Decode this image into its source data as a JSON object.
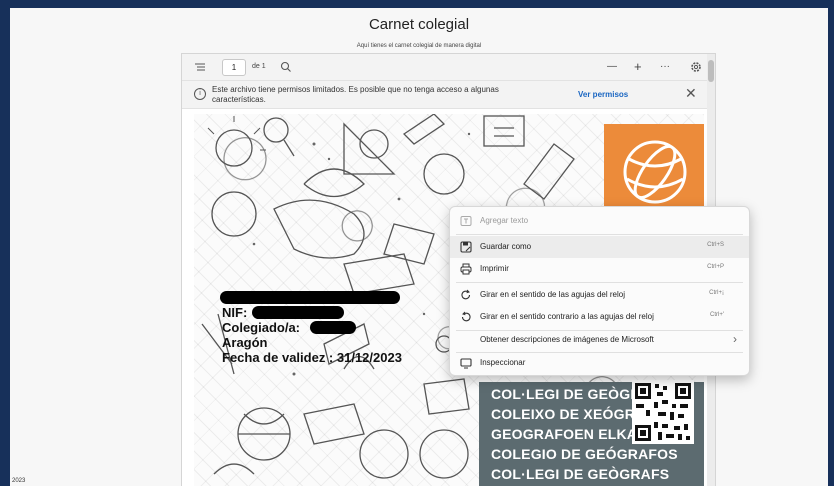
{
  "page": {
    "title": "Carnet colegial",
    "subtitle": "Aquí tienes el carnet colegial de manera digital",
    "footer_year": "2023"
  },
  "viewer": {
    "toolbar": {
      "page_number": "1",
      "page_of": "de 1",
      "zoom_out": "—",
      "zoom_in": "+",
      "more": "···"
    },
    "notice": {
      "icon": "i",
      "text": "Este archivo tiene permisos limitados. Es posible que no tenga acceso a algunas características.",
      "link": "Ver permisos",
      "close": "✕"
    }
  },
  "card": {
    "nif_label": "NIF:",
    "colegiado_label": "Colegiado/a:",
    "region": "Aragón",
    "validity": "Fecha de validez : 31/12/2023",
    "stripes": [
      "COL·LEGI DE GEÒGRAFS",
      "COLEIXO DE XEÓGRAFOS",
      "GEOGRAFOEN ELKARGOA",
      "COLEGIO DE GEÓGRAFOS",
      "COL·LEGI DE GEÒGRAFS"
    ]
  },
  "context_menu": {
    "items": [
      {
        "label": "Agregar texto",
        "shortcut": "",
        "disabled": true
      },
      {
        "label": "Guardar como",
        "shortcut": "Ctrl+S",
        "disabled": false
      },
      {
        "label": "Imprimir",
        "shortcut": "Ctrl+P",
        "disabled": false
      },
      {
        "label": "Girar en el sentido de las agujas del reloj",
        "shortcut": "Ctrl+¡",
        "disabled": false
      },
      {
        "label": "Girar en el sentido contrario a las agujas del reloj",
        "shortcut": "Ctrl+'",
        "disabled": false
      },
      {
        "label": "Obtener descripciones de imágenes de Microsoft",
        "shortcut": "",
        "disabled": false
      },
      {
        "label": "Inspeccionar",
        "shortcut": "",
        "disabled": false
      }
    ],
    "submenu_arrow": "›"
  },
  "colors": {
    "frame": "#17305a",
    "logo_orange": "#ec8b3a",
    "stripe_panel": "#5c6b70",
    "link": "#1a66c2"
  }
}
